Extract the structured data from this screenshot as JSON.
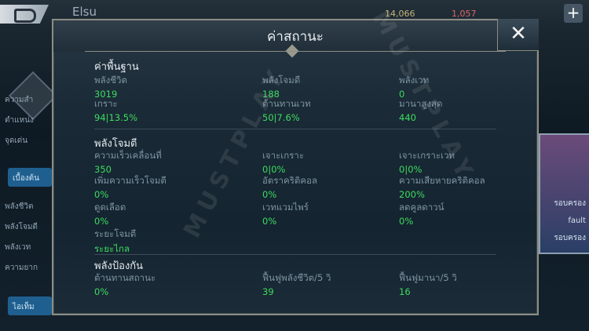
{
  "topbar": {
    "title": "Elsu",
    "stat1": "14,066",
    "stat2": "1,057",
    "plus": "+"
  },
  "left": {
    "items": [
      "ความสำ",
      "ตำแหน่ง",
      "จุดเด่น"
    ],
    "tab1": "เบื้องต้น",
    "rows": [
      "พลังชีวิต",
      "พลังโจมตี",
      "พลังเวท",
      "ความยาก"
    ],
    "tab2": "ไอเท็ม"
  },
  "right": {
    "label1": "รอบครอง",
    "label2": "fault",
    "label3": "รอบครอง"
  },
  "modal": {
    "title": "ค่าสถานะ",
    "close": "✕",
    "sections": {
      "basic": {
        "title": "ค่าพื้นฐาน",
        "stats": [
          {
            "label": "พลังชีวิต",
            "value": "3019"
          },
          {
            "label": "พลังโจมตี",
            "value": "188"
          },
          {
            "label": "พลังเวท",
            "value": "0"
          },
          {
            "label": "เกราะ",
            "value": "94|13.5%"
          },
          {
            "label": "ต้านทานเวท",
            "value": "50|7.6%"
          },
          {
            "label": "มานาสูงสุด",
            "value": "440"
          }
        ]
      },
      "attack": {
        "title": "พลังโจมตี",
        "stats": [
          {
            "label": "ความเร็วเคลื่อนที่",
            "value": "350"
          },
          {
            "label": "เจาะเกราะ",
            "value": "0|0%"
          },
          {
            "label": "เจาะเกราะเวท",
            "value": "0|0%"
          },
          {
            "label": "เพิ่มความเร็วโจมตี",
            "value": "0%"
          },
          {
            "label": "อัตราคริติคอล",
            "value": "0%"
          },
          {
            "label": "ความเสียหายคริติคอล",
            "value": "200%"
          },
          {
            "label": "ดูดเลือด",
            "value": "0%"
          },
          {
            "label": "เวทแวมไพร์",
            "value": "0%"
          },
          {
            "label": "ลดคูลดาวน์",
            "value": "0%"
          },
          {
            "label": "ระยะโจมตี",
            "value": "ระยะไกล"
          }
        ]
      },
      "defense": {
        "title": "พลังป้องกัน",
        "stats": [
          {
            "label": "ต้านทานสถานะ",
            "value": "0%"
          },
          {
            "label": "ฟื้นฟูพลังชีวิต/5 วิ",
            "value": "39"
          },
          {
            "label": "ฟื้นฟูมานา/5 วิ",
            "value": "16"
          }
        ]
      }
    }
  },
  "watermark": "MUSTPLAY"
}
